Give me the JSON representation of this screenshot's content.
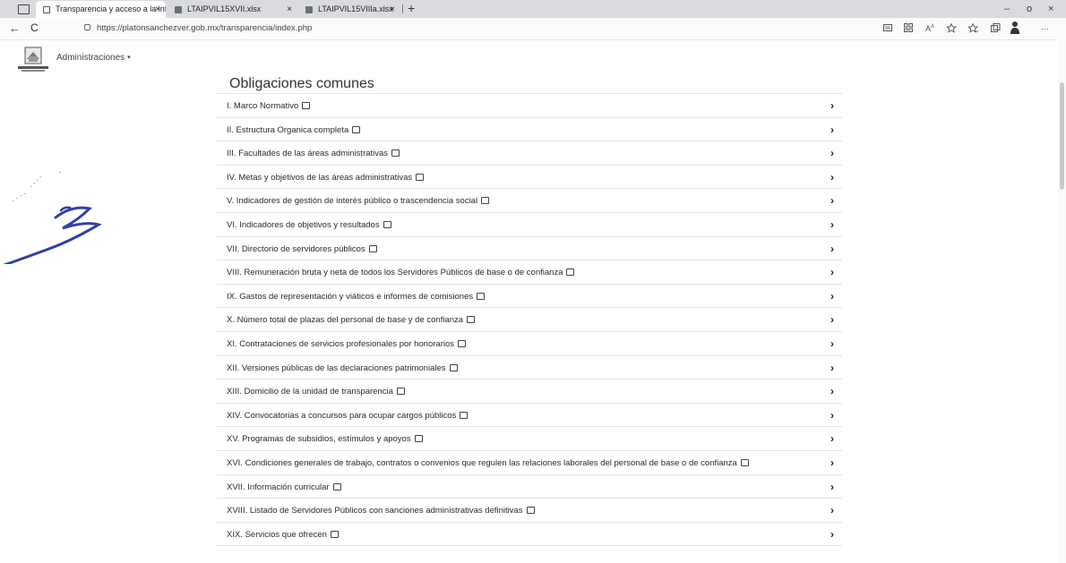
{
  "browser": {
    "tabs": [
      {
        "label": "Transparencia y acceso a la info",
        "close": "×",
        "active": true,
        "icon": "page-icon"
      },
      {
        "label": "LTAIPVIL15XVII.xlsx",
        "close": "×",
        "active": false,
        "icon": "excel-icon"
      },
      {
        "label": "LTAIPVIL15VIIIa.xlsx",
        "close": "×",
        "active": false,
        "icon": "excel-icon"
      }
    ],
    "new_tab": "+",
    "window_controls": {
      "minimize": "–",
      "maximize": "o",
      "close": "×"
    },
    "nav": {
      "back": "←",
      "refresh": "C"
    },
    "url": "https://platonsanchezver.gob.mx/transparencia/index.php",
    "toolbar_icons": [
      "reader-icon",
      "apps-icon",
      "read-aloud-icon",
      "favorite-star-icon",
      "favorites-icon",
      "collections-icon",
      "profile-icon",
      "more-icon"
    ],
    "toolbar_more": "···"
  },
  "site": {
    "admin_menu_label": "Administraciones",
    "admin_menu_caret": "▾"
  },
  "main": {
    "title": "Obligaciones comunes",
    "items": [
      {
        "label": "I. Marco Normativo"
      },
      {
        "label": "II. Estructura Organica completa"
      },
      {
        "label": "III. Facultades de las áreas administrativas"
      },
      {
        "label": "IV. Metas y objetivos de las áreas administrativas"
      },
      {
        "label": "V. Indicadores de gestión de interés público o trascendencia social"
      },
      {
        "label": "VI. Indicadores de objetivos y resultados"
      },
      {
        "label": "VII. Directorio de servidores públicos"
      },
      {
        "label": "VIII. Remuneración bruta y neta de todos los Servidores Públicos de base o de confianza"
      },
      {
        "label": "IX. Gastos de representación y viáticos e informes de comisiones"
      },
      {
        "label": "X. Número total de plazas del personal de base y de confianza"
      },
      {
        "label": "XI. Contrataciones de servicios profesionales por honorarios"
      },
      {
        "label": "XII. Versiones públicas de las declaraciones patrimoniales"
      },
      {
        "label": "XIII. Domicilio de la unidad de transparencia"
      },
      {
        "label": "XIV. Convocatorias a concursos para ocupar cargos públicos"
      },
      {
        "label": "XV. Programas de subsidios, estímulos y apoyos"
      },
      {
        "label": "XVI. Condiciones generales de trabajo, contratos o convenios que regulen las relaciones laborales del personal de base o de confianza"
      },
      {
        "label": "XVII. Información curricular"
      },
      {
        "label": "XVIII. Listado de Servidores Públicos con sanciones administrativas definitivas"
      },
      {
        "label": "XIX. Servicios que ofrecen"
      }
    ],
    "chevron": "›"
  }
}
